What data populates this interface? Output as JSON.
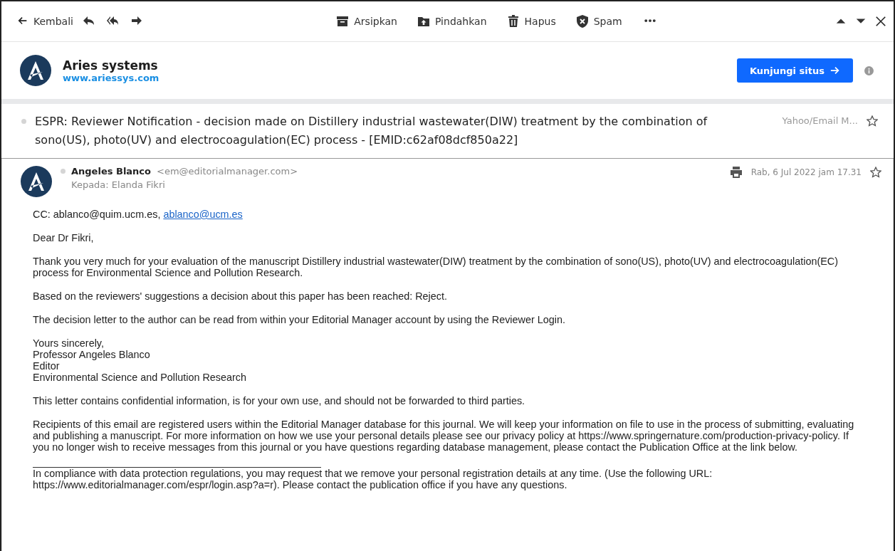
{
  "toolbar": {
    "back": "Kembali",
    "actions": [
      {
        "kind": "archive",
        "label": "Arsipkan"
      },
      {
        "kind": "move",
        "label": "Pindahkan"
      },
      {
        "kind": "delete",
        "label": "Hapus"
      },
      {
        "kind": "spam",
        "label": "Spam"
      }
    ]
  },
  "sender_banner": {
    "name": "Aries systems",
    "url": "www.ariessys.com",
    "button": "Kunjungi situs"
  },
  "subject": {
    "text": "ESPR: Reviewer Notification - decision made on Distillery industrial wastewater(DIW) treatment by the combination of sono(US), photo(UV) and electrocoagulation(EC) process - [EMID:c62af08dcf850a22]",
    "folder": "Yahoo/Email M...",
    "starred": false
  },
  "message": {
    "from_name": "Angeles Blanco",
    "from_email": "<em@editorialmanager.com>",
    "to": "Kepada: Elanda Fikri",
    "date": "Rab, 6 Jul 2022 jam 17.31",
    "starred": false,
    "body": [
      {
        "kind": "cc",
        "label": "CC:",
        "addresses": [
          {
            "text": "ablanco@quim.ucm.es,",
            "link": false
          },
          {
            "text": "ablanco@ucm.es",
            "link": true
          }
        ]
      },
      {
        "kind": "p",
        "text": "Dear Dr Fikri,"
      },
      {
        "kind": "p",
        "text": "Thank you very much for your evaluation of the manuscript Distillery industrial wastewater(DIW) treatment by the combination of sono(US), photo(UV) and electrocoagulation(EC) process for Environmental Science and Pollution Research."
      },
      {
        "kind": "p",
        "text": "Based on the reviewers' suggestions a decision about this paper has been reached: Reject."
      },
      {
        "kind": "p",
        "text": "The decision letter to the author can be read from within your Editorial Manager account by using the Reviewer Login."
      },
      {
        "kind": "lines",
        "lines": [
          "Yours sincerely,",
          "Professor Angeles Blanco",
          "Editor",
          "Environmental Science and Pollution Research"
        ]
      },
      {
        "kind": "p",
        "text": "This letter contains confidential information, is for your own use, and should not be forwarded to third parties."
      },
      {
        "kind": "p",
        "text": "Recipients of this email are registered users within the Editorial Manager database for this journal. We will keep your information on file to use in the process of submitting, evaluating and publishing a manuscript. For more information on how we use your personal details please see our privacy policy at https://www.springernature.com/production-privacy-policy. If you no longer wish to receive messages from this journal or you have questions regarding database management, please contact the Publication Office at the link below."
      },
      {
        "kind": "rule"
      },
      {
        "kind": "p",
        "text": "In compliance with data protection regulations, you may request that we remove your personal registration details at any time.  (Use the following URL: https://www.editorialmanager.com/espr/login.asp?a=r). Please contact the publication office if you have any questions."
      }
    ]
  }
}
